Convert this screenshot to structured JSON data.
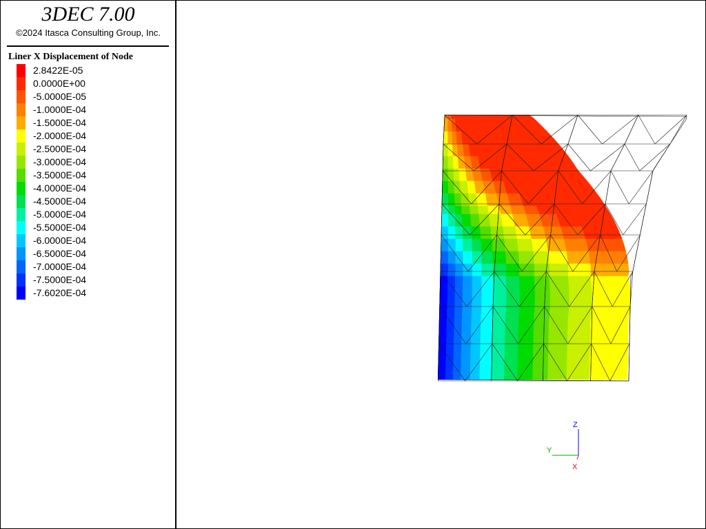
{
  "header": {
    "app_title": "3DEC 7.00",
    "copyright": "©2024 Itasca Consulting Group, Inc."
  },
  "legend": {
    "title": "Liner X Displacement of Node",
    "entries": [
      {
        "label": "2.8422E-05",
        "color": "#ff0000"
      },
      {
        "label": "0.0000E+00",
        "color": "#ff2a00"
      },
      {
        "label": "-5.0000E-05",
        "color": "#ff5500"
      },
      {
        "label": "-1.0000E-04",
        "color": "#ff8000"
      },
      {
        "label": "-1.5000E-04",
        "color": "#ffaa00"
      },
      {
        "label": "-2.0000E-04",
        "color": "#ffff00"
      },
      {
        "label": "-2.5000E-04",
        "color": "#c8f000"
      },
      {
        "label": "-3.0000E-04",
        "color": "#96e600"
      },
      {
        "label": "-3.5000E-04",
        "color": "#55dc00"
      },
      {
        "label": "-4.0000E-04",
        "color": "#00dc00"
      },
      {
        "label": "-4.5000E-04",
        "color": "#00e050"
      },
      {
        "label": "-5.0000E-04",
        "color": "#00f0a0"
      },
      {
        "label": "-5.5000E-04",
        "color": "#00ffff"
      },
      {
        "label": "-6.0000E-04",
        "color": "#00c8ff"
      },
      {
        "label": "-6.5000E-04",
        "color": "#0096ff"
      },
      {
        "label": "-7.0000E-04",
        "color": "#0064ff"
      },
      {
        "label": "-7.5000E-04",
        "color": "#0032ff"
      },
      {
        "label": "-7.6020E-04",
        "color": "#0000ff"
      }
    ]
  },
  "axes": {
    "z_label": "Z",
    "y_label": "Y",
    "x_label": "X",
    "z_color": "#0000ff",
    "y_color": "#00aa00",
    "x_color": "#ff0000"
  }
}
